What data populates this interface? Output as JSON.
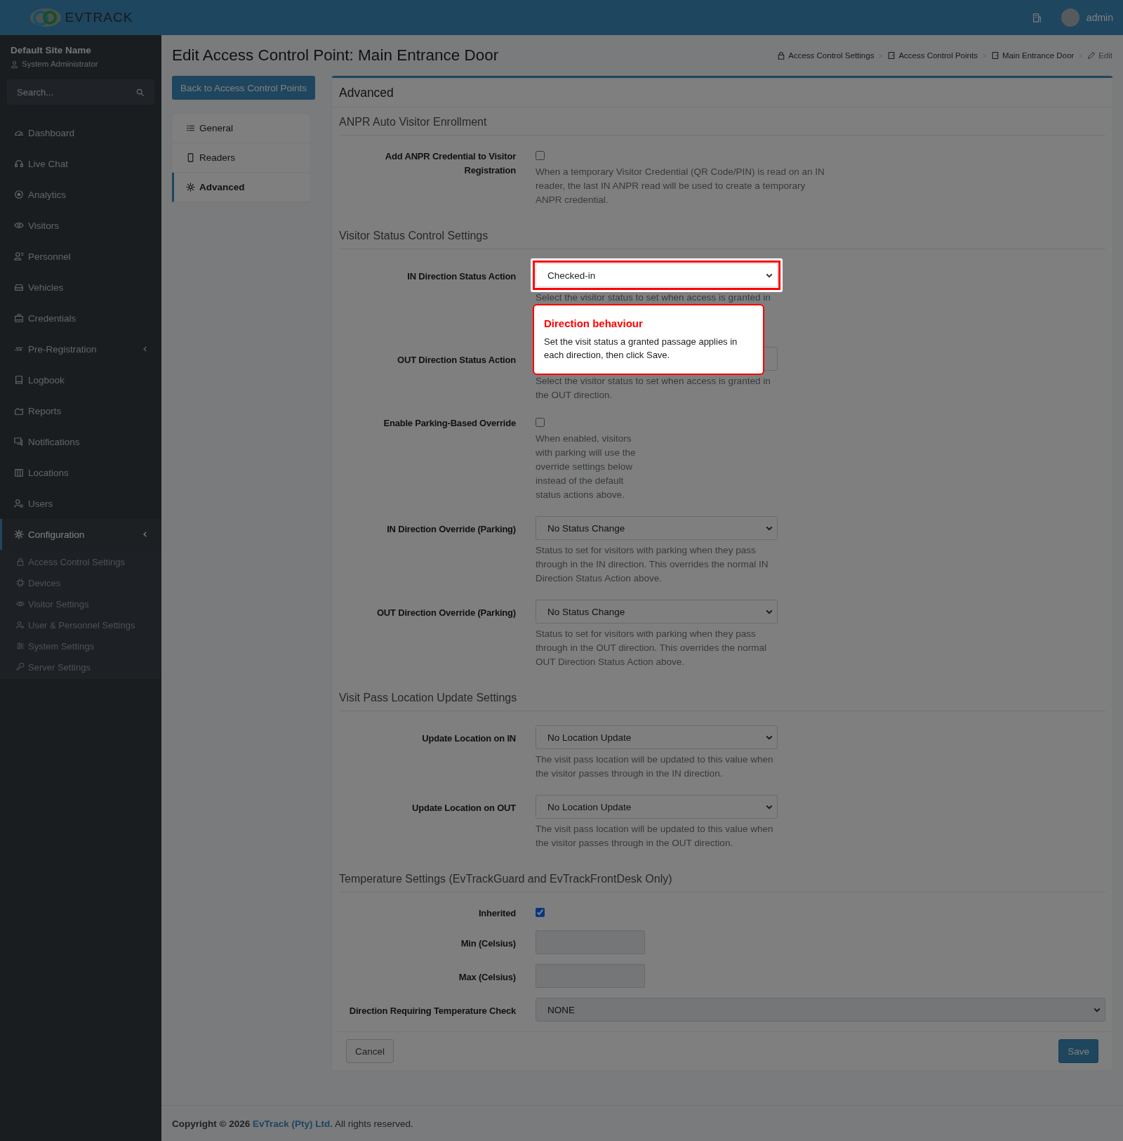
{
  "header": {
    "logo": "**EV**TRACK",
    "user": "admin"
  },
  "sidebar": {
    "site_name": "Default Site Name",
    "role": "System Administrator",
    "search": {
      "placeholder": "Search..."
    },
    "items": [
      {
        "label": "Dashboard",
        "kind": "link",
        "selected": false
      },
      {
        "label": "Live Chat",
        "kind": "link",
        "selected": false
      },
      {
        "label": "Analytics",
        "kind": "link",
        "selected": false
      },
      {
        "label": "Visitors",
        "kind": "link",
        "selected": false
      },
      {
        "label": "Personnel",
        "kind": "link",
        "selected": false
      },
      {
        "label": "Vehicles",
        "kind": "link",
        "selected": false
      },
      {
        "label": "Credentials",
        "kind": "link",
        "selected": false
      },
      {
        "label": "Pre-Registration",
        "kind": "group",
        "selected": false,
        "expanded": false
      },
      {
        "label": "Logbook",
        "kind": "link",
        "selected": false
      },
      {
        "label": "Reports",
        "kind": "link",
        "selected": false
      },
      {
        "label": "Notifications",
        "kind": "link",
        "selected": false
      },
      {
        "label": "Locations",
        "kind": "link",
        "selected": false
      },
      {
        "label": "Users",
        "kind": "link",
        "selected": false
      },
      {
        "label": "Configuration",
        "kind": "group",
        "selected": true,
        "expanded": true,
        "children": [
          {
            "label": "Access Control Settings"
          },
          {
            "label": "Devices"
          },
          {
            "label": "Visitor Settings"
          },
          {
            "label": "User & Personnel Settings"
          },
          {
            "label": "System Settings"
          },
          {
            "label": "Server Settings"
          }
        ]
      }
    ]
  },
  "page": {
    "title": "Edit Access Control Point: Main Entrance Door",
    "breadcrumbs": [
      "Access Control Settings",
      "Access Control Points",
      "Main Entrance Door",
      "Edit"
    ],
    "back_button": "Back to Access Control Points",
    "tabs": [
      {
        "label": "General",
        "selected": false
      },
      {
        "label": "Readers",
        "selected": false
      },
      {
        "label": "Advanced",
        "selected": true
      }
    ]
  },
  "card": {
    "title": "Advanced",
    "sections": [
      {
        "title": "ANPR Auto Visitor Enrollment",
        "fields": [
          {
            "label": "Add ANPR Credential to Visitor Registration",
            "kind": "checkbox",
            "checked": false,
            "highlighted": false,
            "help": "When a temporary Visitor Credential (QR Code/PIN) is read on an IN reader, the last IN ANPR read will be used to create a temporary ANPR credential."
          }
        ]
      },
      {
        "title": "Visitor Status Control Settings",
        "fields": [
          {
            "label": "IN Direction Status Action",
            "kind": "select",
            "value": "Checked-in",
            "highlighted": true,
            "help": "Select the visitor status to set when access is granted in"
          },
          {
            "label": "OUT Direction Status Action",
            "kind": "select",
            "highlighted": false,
            "help": "Select the visitor status to set when access is granted in the OUT direction."
          },
          {
            "label": "Enable Parking-Based Override",
            "kind": "checkbox",
            "checked": false,
            "highlighted": false,
            "help": "When enabled, visitors with parking will use the override settings below instead of the default status actions above."
          },
          {
            "label": "IN Direction Override (Parking)",
            "kind": "select",
            "value": "No Status Change",
            "highlighted": false,
            "help": "Status to set for visitors with parking when they pass through in the IN direction. This overrides the normal IN Direction Status Action above."
          },
          {
            "label": "OUT Direction Override (Parking)",
            "kind": "select",
            "value": "No Status Change",
            "highlighted": false,
            "help": "Status to set for visitors with parking when they pass through in the OUT direction. This overrides the normal OUT Direction Status Action above."
          }
        ]
      },
      {
        "title": "Visit Pass Location Update Settings",
        "fields": [
          {
            "label": "Update Location on IN",
            "kind": "select",
            "value": "No Location Update",
            "highlighted": false,
            "help": "The visit pass location will be updated to this value when the visitor passes through in the IN direction."
          },
          {
            "label": "Update Location on OUT",
            "kind": "select",
            "value": "No Location Update",
            "highlighted": false,
            "help": "The visit pass location will be updated to this value when the visitor passes through in the OUT direction."
          }
        ]
      },
      {
        "title": "Temperature Settings (EvTrackGuard and EvTrackFrontDesk Only)",
        "fields": [
          {
            "label": "Inherited",
            "kind": "checkbox",
            "checked": true,
            "highlighted": false
          },
          {
            "label": "Min (Celsius)",
            "kind": "text",
            "highlighted": false
          },
          {
            "label": "Max (Celsius)",
            "kind": "text",
            "highlighted": false
          },
          {
            "label": "Direction Requiring Temperature Check",
            "kind": "wide-select",
            "value": "NONE",
            "highlighted": false
          }
        ]
      }
    ],
    "cancel_button": "Cancel",
    "save_button": "Save"
  },
  "tour": {
    "title": "Direction behaviour",
    "body": "Set the visit status a granted passage applies in each direction, then click Save."
  },
  "footer": {
    "prefix": "**Copyright © 2026**",
    "link": "EvTrack (Pty) Ltd.",
    "suffix": " All rights reserved."
  }
}
